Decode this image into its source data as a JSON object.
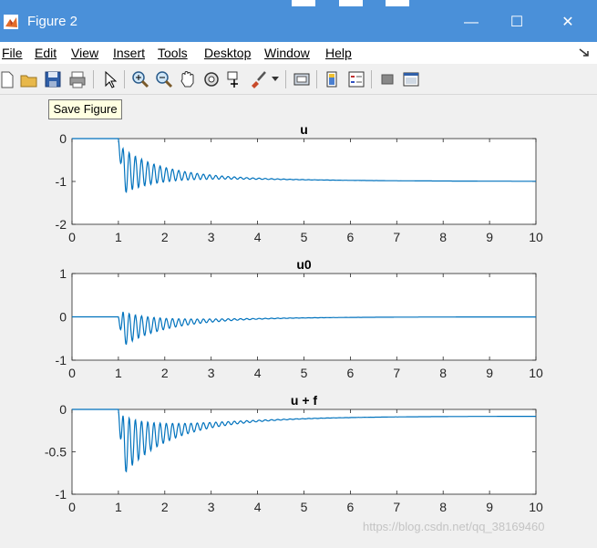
{
  "window": {
    "title": "Figure 2",
    "controls": {
      "minimize": "—",
      "maximize": "☐",
      "close": "✕"
    }
  },
  "menu": [
    {
      "label": "File",
      "mnemonic_index": 0
    },
    {
      "label": "Edit",
      "mnemonic_index": 0
    },
    {
      "label": "View",
      "mnemonic_index": 0
    },
    {
      "label": "Insert",
      "mnemonic_index": 0
    },
    {
      "label": "Tools",
      "mnemonic_index": 0
    },
    {
      "label": "Desktop",
      "mnemonic_index": 0
    },
    {
      "label": "Window",
      "mnemonic_index": 0
    },
    {
      "label": "Help",
      "mnemonic_index": 0
    }
  ],
  "toolbar": {
    "items": [
      "new-figure-icon",
      "open-file-icon",
      "save-figure-icon",
      "print-figure-icon",
      "pointer-icon",
      "zoom-in-icon",
      "zoom-out-icon",
      "pan-hand-icon",
      "rotate-3d-icon",
      "data-cursor-icon",
      "brush-icon",
      "brush-dropdown-icon",
      "link-plot-icon",
      "insert-colorbar-icon",
      "insert-legend-icon",
      "hide-plot-tools-icon",
      "show-plot-tools-icon"
    ],
    "tooltip": "Save Figure"
  },
  "watermark": "https://blog.csdn.net/qq_38169460",
  "colors": {
    "line": "#0072bd",
    "titlebar": "#4a90d9"
  },
  "chart_data": [
    {
      "type": "line",
      "title": "u",
      "xlim": [
        0,
        10
      ],
      "ylim": [
        -2,
        0
      ],
      "xticks": [
        "0",
        "1",
        "2",
        "3",
        "4",
        "5",
        "6",
        "7",
        "8",
        "9",
        "10"
      ],
      "yticks": [
        "0",
        "-1",
        "-2"
      ],
      "ytick_values": [
        0,
        -1,
        -2
      ],
      "series": [
        {
          "model": {
            "start": 1.0,
            "final": -1.0,
            "tau": 2.2,
            "osc_amp": 0.6,
            "osc_decay": 0.8,
            "osc_freq": 7.5
          },
          "x": [
            0,
            1.0,
            1.1,
            1.15,
            1.2,
            1.3,
            1.5,
            2,
            3,
            4,
            5,
            6,
            7,
            8,
            9,
            10
          ],
          "y": [
            0,
            0,
            -1.3,
            -1.45,
            -1.1,
            -0.55,
            -0.95,
            -0.75,
            -0.78,
            -0.84,
            -0.88,
            -0.93,
            -0.96,
            -0.98,
            -0.99,
            -1.0
          ]
        }
      ]
    },
    {
      "type": "line",
      "title": "u0",
      "xlim": [
        0,
        10
      ],
      "ylim": [
        -1,
        1
      ],
      "xticks": [
        "0",
        "1",
        "2",
        "3",
        "4",
        "5",
        "6",
        "7",
        "8",
        "9",
        "10"
      ],
      "yticks": [
        "1",
        "0",
        "-1"
      ],
      "ytick_values": [
        1,
        0,
        -1
      ],
      "series": [
        {
          "model": {
            "start": 1.0,
            "final": 0.0,
            "tau": 1.6,
            "osc_amp": 0.45,
            "osc_decay": 0.8,
            "osc_freq": 7.5,
            "base": -0.3
          },
          "x": [
            0,
            1.0,
            1.1,
            1.15,
            1.2,
            1.3,
            2,
            3,
            4,
            5,
            6,
            7,
            8,
            9,
            10
          ],
          "y": [
            0,
            0,
            -0.55,
            -0.63,
            -0.35,
            -0.15,
            -0.2,
            -0.15,
            -0.1,
            -0.05,
            -0.02,
            -0.01,
            0,
            0,
            0
          ]
        }
      ]
    },
    {
      "type": "line",
      "title": "u + f",
      "xlim": [
        0,
        10
      ],
      "ylim": [
        -1,
        0
      ],
      "xticks": [
        "0",
        "1",
        "2",
        "3",
        "4",
        "5",
        "6",
        "7",
        "8",
        "9",
        "10"
      ],
      "yticks": [
        "0",
        "-0.5",
        "-1"
      ],
      "ytick_values": [
        0,
        -0.5,
        -1
      ],
      "series": [
        {
          "model": {
            "start": 1.0,
            "final": -0.08,
            "tau": 1.6,
            "osc_amp": 0.4,
            "osc_decay": 0.8,
            "osc_freq": 7.5,
            "base": -0.45
          },
          "x": [
            0,
            1.0,
            1.1,
            1.15,
            1.2,
            1.3,
            2,
            3,
            4,
            5,
            6,
            7,
            8,
            9,
            10
          ],
          "y": [
            0,
            0,
            -0.72,
            -0.77,
            -0.45,
            -0.3,
            -0.35,
            -0.25,
            -0.17,
            -0.12,
            -0.1,
            -0.09,
            -0.08,
            -0.08,
            -0.08
          ]
        }
      ]
    }
  ]
}
